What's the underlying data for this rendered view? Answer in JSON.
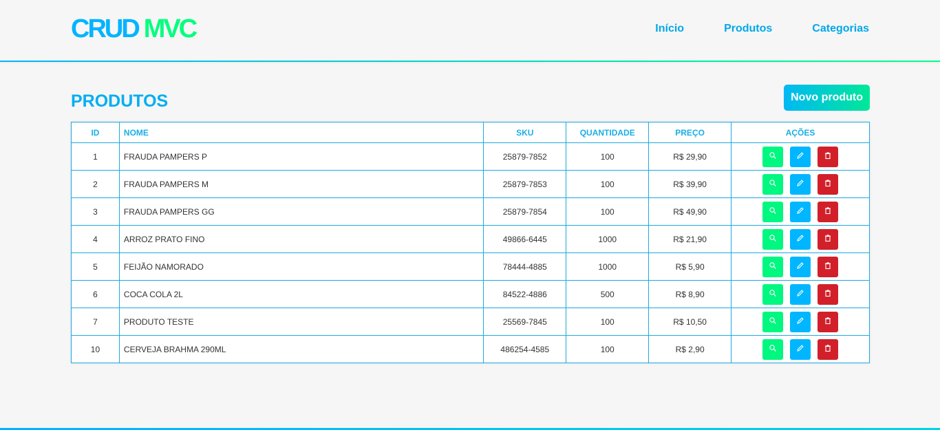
{
  "logo": {
    "part1": "CRUD",
    "part2": "MVC"
  },
  "nav": [
    {
      "label": "Início"
    },
    {
      "label": "Produtos"
    },
    {
      "label": "Categorias"
    }
  ],
  "page": {
    "title": "PRODUTOS",
    "new_button": "Novo produto"
  },
  "table": {
    "headers": [
      "ID",
      "NOME",
      "SKU",
      "QUANTIDADE",
      "PREÇO",
      "AÇÕES"
    ],
    "rows": [
      {
        "id": "1",
        "nome": "FRAUDA PAMPERS P",
        "sku": "25879-7852",
        "quantidade": "100",
        "preco": "R$ 29,90"
      },
      {
        "id": "2",
        "nome": "FRAUDA PAMPERS M",
        "sku": "25879-7853",
        "quantidade": "100",
        "preco": "R$ 39,90"
      },
      {
        "id": "3",
        "nome": "FRAUDA PAMPERS GG",
        "sku": "25879-7854",
        "quantidade": "100",
        "preco": "R$ 49,90"
      },
      {
        "id": "4",
        "nome": "ARROZ PRATO FINO",
        "sku": "49866-6445",
        "quantidade": "1000",
        "preco": "R$ 21,90"
      },
      {
        "id": "5",
        "nome": "FEIJÃO NAMORADO",
        "sku": "78444-4885",
        "quantidade": "1000",
        "preco": "R$ 5,90"
      },
      {
        "id": "6",
        "nome": "COCA COLA 2L",
        "sku": "84522-4886",
        "quantidade": "500",
        "preco": "R$ 8,90"
      },
      {
        "id": "7",
        "nome": "PRODUTO TESTE",
        "sku": "25569-7845",
        "quantidade": "100",
        "preco": "R$ 10,50"
      },
      {
        "id": "10",
        "nome": "CERVEJA BRAHMA 290ML",
        "sku": "486254-4585",
        "quantidade": "100",
        "preco": "R$ 2,90"
      }
    ],
    "action_icons": {
      "view": "search-icon",
      "edit": "pencil-icon",
      "delete": "trash-icon"
    }
  },
  "colors": {
    "primary": "#00b4ff",
    "accent": "#00ff7f",
    "view_button": "#00f780",
    "edit_button": "#00b6ff",
    "delete_button": "#d2202a"
  }
}
